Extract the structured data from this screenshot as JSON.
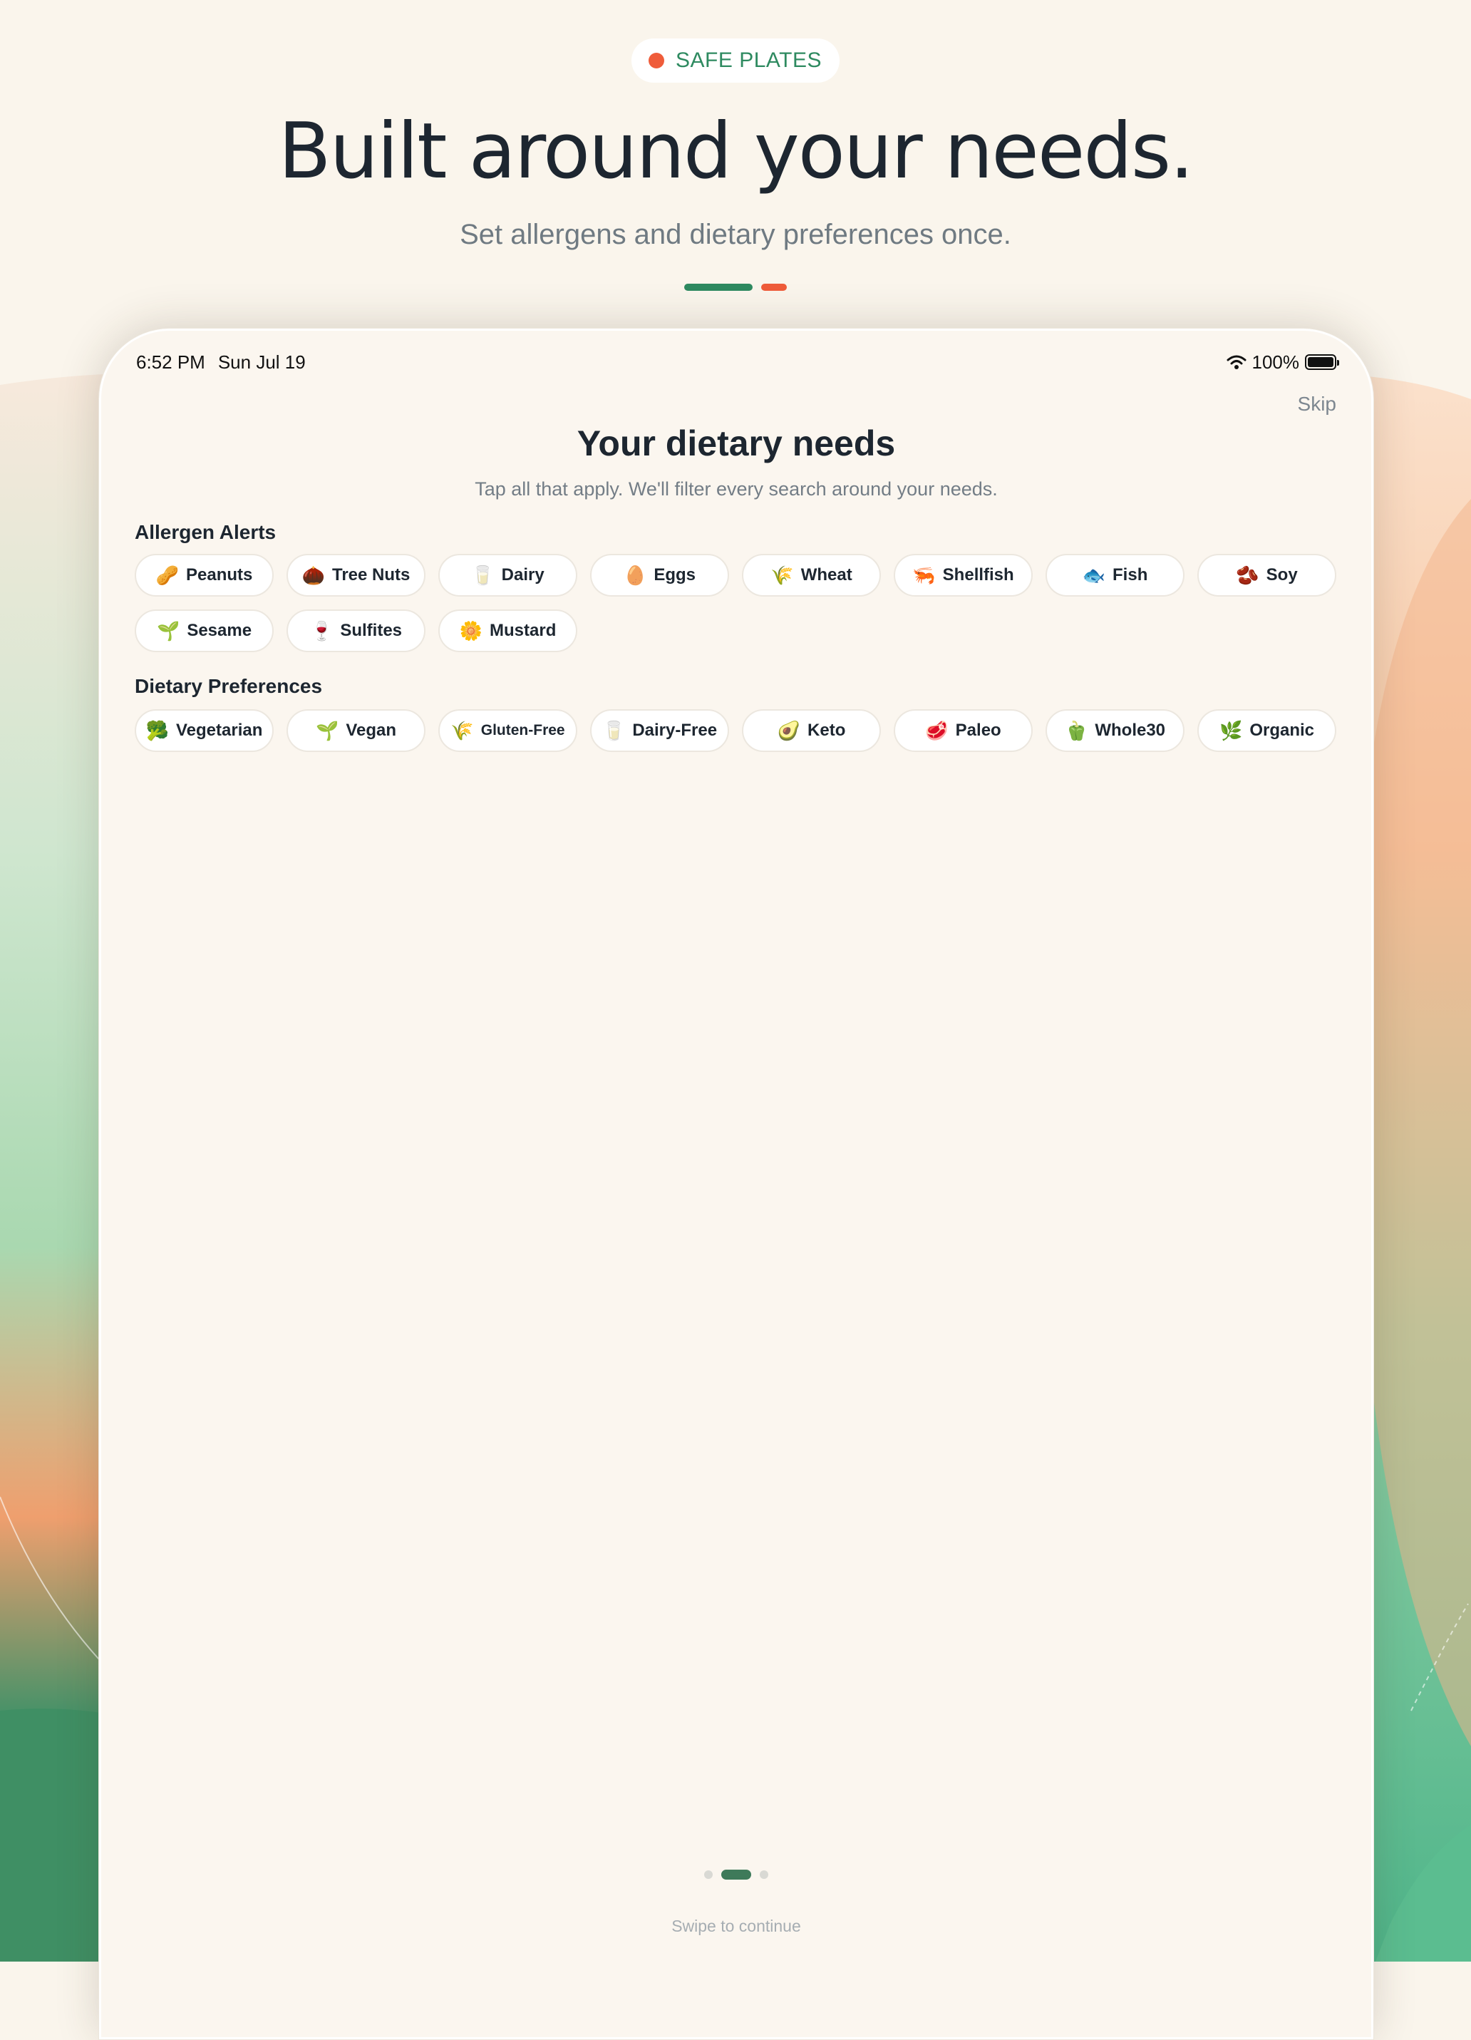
{
  "colors": {
    "accent_green": "#2e8a60",
    "accent_orange": "#ef5c3a",
    "text_dark": "#1d2630",
    "background": "#faf5ec"
  },
  "marketing": {
    "brand": "SAFE PLATES",
    "title": "Built around your needs.",
    "subtitle": "Set allergens and dietary preferences once."
  },
  "status_bar": {
    "time": "6:52 PM",
    "date": "Sun Jul 19",
    "battery": "100%",
    "wifi_icon": "wifi-icon",
    "battery_icon": "battery-icon"
  },
  "screen": {
    "skip": "Skip",
    "title": "Your dietary needs",
    "subtitle": "Tap all that apply. We'll filter every search around your needs."
  },
  "allergens": {
    "label": "Allergen Alerts",
    "items": [
      {
        "label": "Peanuts",
        "icon": "🥜",
        "icon_name": "peanut-icon"
      },
      {
        "label": "Tree Nuts",
        "icon": "🌰",
        "icon_name": "chestnut-icon"
      },
      {
        "label": "Dairy",
        "icon": "🥛",
        "icon_name": "milk-icon"
      },
      {
        "label": "Eggs",
        "icon": "🥚",
        "icon_name": "egg-icon"
      },
      {
        "label": "Wheat",
        "icon": "🌾",
        "icon_name": "wheat-icon"
      },
      {
        "label": "Shellfish",
        "icon": "🦐",
        "icon_name": "shrimp-icon"
      },
      {
        "label": "Fish",
        "icon": "🐟",
        "icon_name": "fish-icon"
      },
      {
        "label": "Soy",
        "icon": "🫘",
        "icon_name": "beans-icon"
      },
      {
        "label": "Sesame",
        "icon": "🌱",
        "icon_name": "seedling-icon"
      },
      {
        "label": "Sulfites",
        "icon": "🍷",
        "icon_name": "wine-icon"
      },
      {
        "label": "Mustard",
        "icon": "🌼",
        "icon_name": "flower-icon"
      }
    ]
  },
  "preferences": {
    "label": "Dietary Preferences",
    "items": [
      {
        "label": "Vegetarian",
        "icon": "🥦",
        "icon_name": "broccoli-icon"
      },
      {
        "label": "Vegan",
        "icon": "🌱",
        "icon_name": "seedling-icon"
      },
      {
        "label": "Gluten-Free",
        "icon": "🌾",
        "icon_name": "wheat-icon"
      },
      {
        "label": "Dairy-Free",
        "icon": "🥛",
        "icon_name": "milk-icon"
      },
      {
        "label": "Keto",
        "icon": "🥑",
        "icon_name": "avocado-icon"
      },
      {
        "label": "Paleo",
        "icon": "🥩",
        "icon_name": "meat-icon"
      },
      {
        "label": "Whole30",
        "icon": "🫑",
        "icon_name": "pepper-icon"
      },
      {
        "label": "Organic",
        "icon": "🌿",
        "icon_name": "herb-icon"
      }
    ]
  },
  "pager": {
    "pages": 3,
    "current": 2
  },
  "footer": {
    "hint": "Swipe to continue"
  }
}
